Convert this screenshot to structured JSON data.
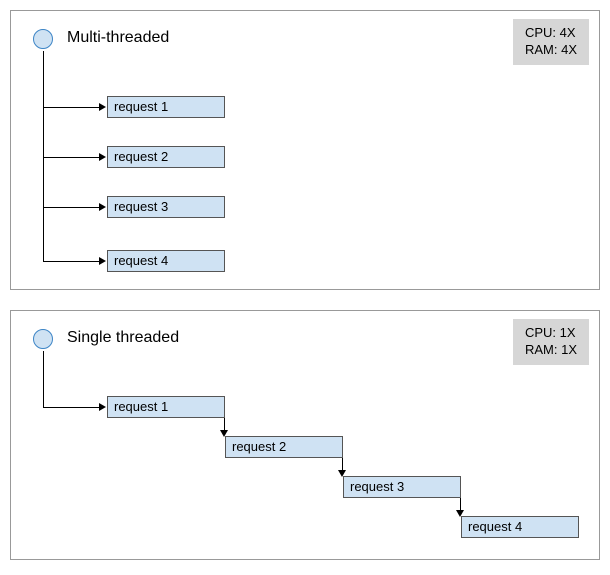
{
  "multi": {
    "title": "Multi-threaded",
    "stats": {
      "cpu": "CPU: 4X",
      "ram": "RAM: 4X"
    },
    "requests": [
      "request 1",
      "request 2",
      "request 3",
      "request 4"
    ]
  },
  "single": {
    "title": "Single threaded",
    "stats": {
      "cpu": "CPU: 1X",
      "ram": "RAM: 1X"
    },
    "requests": [
      "request 1",
      "request 2",
      "request 3",
      "request 4"
    ]
  },
  "chart_data": [
    {
      "type": "diagram",
      "title": "Multi-threaded",
      "model": "parallel",
      "node": "origin",
      "requests": [
        "request 1",
        "request 2",
        "request 3",
        "request 4"
      ],
      "resources": {
        "CPU": "4X",
        "RAM": "4X"
      },
      "description": "Single origin node fans out to four request boxes in parallel."
    },
    {
      "type": "diagram",
      "title": "Single threaded",
      "model": "sequential",
      "node": "origin",
      "requests": [
        "request 1",
        "request 2",
        "request 3",
        "request 4"
      ],
      "resources": {
        "CPU": "1X",
        "RAM": "1X"
      },
      "description": "Single origin node feeds requests sequentially; each request starts after the previous ends, forming a staircase."
    }
  ]
}
